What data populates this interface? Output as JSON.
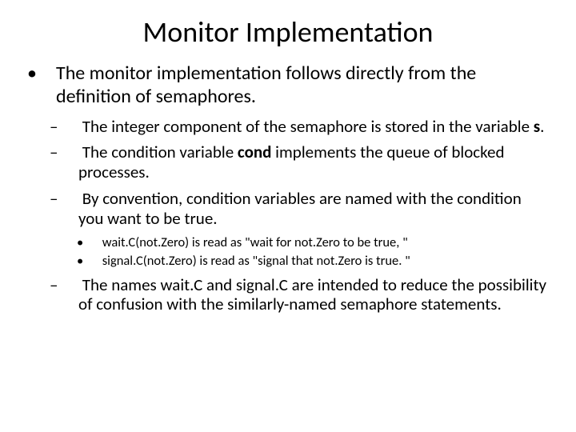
{
  "title": "Monitor Implementation",
  "p1": "The monitor implementation follows directly from the definition of semaphores.",
  "s1a": " The integer component of the semaphore is stored in the variable ",
  "s1b": "s",
  "s1c": ".",
  "s2a": " The condition variable ",
  "s2b": "cond",
  "s2c": " implements the queue of blocked processes.",
  "s3": " By convention, condition variables are named with the condition you want to be true.",
  "t1": " wait.C(not.Zero) is read as \"wait for not.Zero to be true, \"",
  "t2": " signal.C(not.Zero) is read as \"signal that not.Zero is true. \"",
  "s4": " The names wait.C and signal.C are intended to reduce the possibility of confusion with the similarly-named semaphore statements."
}
